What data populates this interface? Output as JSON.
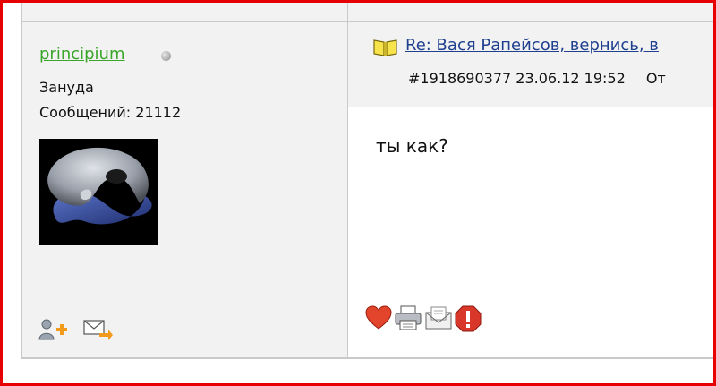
{
  "user": {
    "name": "principium",
    "title": "Зануда",
    "post_count": "Сообщений: 21112",
    "status": "offline"
  },
  "post": {
    "title": "Re: Вася Рапейсов, вернись, в",
    "id": "#1918690377",
    "datetime": "23.06.12 19:52",
    "from_label": "От",
    "body": "ты как?"
  },
  "icons": {
    "user": [
      "add-friend-icon",
      "send-message-icon"
    ],
    "actions": [
      "like-heart-icon",
      "print-icon",
      "email-icon",
      "report-icon"
    ],
    "header": "book-icon"
  },
  "colors": {
    "frame": "#e60000",
    "username": "#3aa52a",
    "link": "#1f3f8f",
    "panel": "#f2f2f2"
  }
}
